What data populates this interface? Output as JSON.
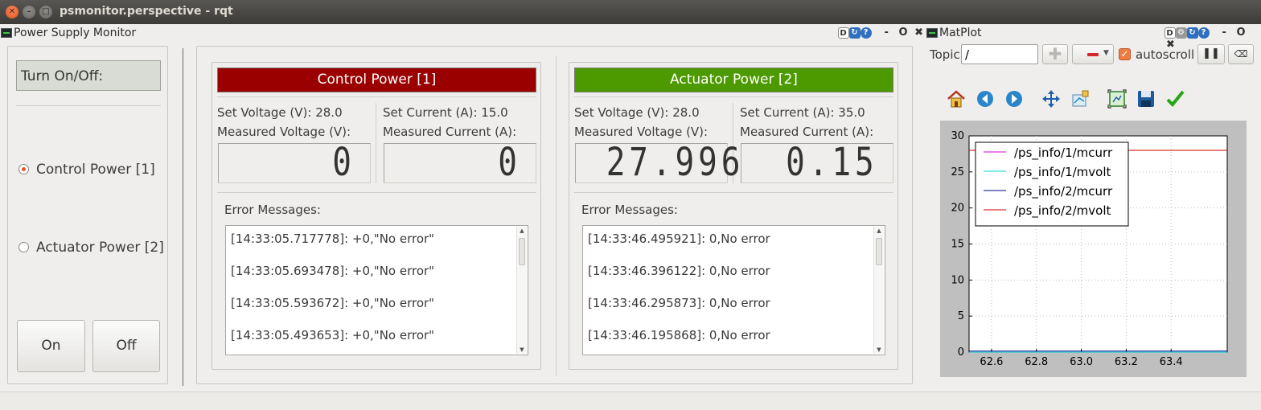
{
  "window": {
    "title": "psmonitor.perspective - rqt"
  },
  "psm": {
    "dock_title": "Power Supply Monitor",
    "turn_label": "Turn On/Off:",
    "radio_options": [
      {
        "label": "Control Power [1]",
        "checked": true
      },
      {
        "label": "Actuator Power [2]",
        "checked": false
      }
    ],
    "on_label": "On",
    "off_label": "Off",
    "supplies": [
      {
        "header": "Control Power [1]",
        "header_color": "#9b0000",
        "set_voltage_label": "Set Voltage (V): 28.0",
        "set_current_label": "Set Current (A): 15.0",
        "meas_voltage_label": "Measured Voltage (V):",
        "meas_current_label": "Measured Current (A):",
        "voltage_lcd": "0",
        "current_lcd": "0",
        "errors_label": "Error Messages:",
        "messages": [
          "[14:33:05.717778]: +0,\"No error\"",
          "[14:33:05.693478]: +0,\"No error\"",
          "[14:33:05.593672]: +0,\"No error\"",
          "[14:33:05.493653]: +0,\"No error\""
        ]
      },
      {
        "header": "Actuator Power [2]",
        "header_color": "#4c9a00",
        "set_voltage_label": "Set Voltage (V): 28.0",
        "set_current_label": "Set Current (A): 35.0",
        "meas_voltage_label": "Measured Voltage (V):",
        "meas_current_label": "Measured Current (A):",
        "voltage_lcd": "27.996",
        "current_lcd": "0.15",
        "errors_label": "Error Messages:",
        "messages": [
          "[14:33:46.495921]: 0,No error",
          "[14:33:46.396122]: 0,No error",
          "[14:33:46.295873]: 0,No error",
          "[14:33:46.195868]: 0,No error"
        ]
      }
    ]
  },
  "matplot": {
    "dock_title": "MatPlot",
    "topic_label": "Topic",
    "topic_value": "/",
    "autoscroll_label": "autoscroll",
    "autoscroll_checked": true,
    "toolbar_icons": [
      "home-icon",
      "back-icon",
      "forward-icon",
      "pan-icon",
      "subplots-icon",
      "zoom-icon",
      "save-icon",
      "check-icon"
    ]
  },
  "chart_data": {
    "type": "line",
    "xlim": [
      62.5,
      63.65
    ],
    "ylim": [
      0,
      30
    ],
    "xticks": [
      "62.6",
      "62.8",
      "63.0",
      "63.2",
      "63.4"
    ],
    "xtick_values": [
      62.6,
      62.8,
      63.0,
      63.2,
      63.4
    ],
    "yticks": [
      "0",
      "5",
      "10",
      "15",
      "20",
      "25",
      "30"
    ],
    "ytick_values": [
      0,
      5,
      10,
      15,
      20,
      25,
      30
    ],
    "grid": true,
    "legend_placement": "top-left",
    "series": [
      {
        "name": "/ps_info/1/mcurr",
        "color": "#d400d4",
        "x": [
          62.5,
          63.65
        ],
        "y": [
          0,
          0
        ]
      },
      {
        "name": "/ps_info/1/mvolt",
        "color": "#00d4d4",
        "x": [
          62.5,
          63.65
        ],
        "y": [
          0,
          0
        ]
      },
      {
        "name": "/ps_info/2/mcurr",
        "color": "#00008b",
        "x": [
          62.5,
          63.65
        ],
        "y": [
          0.15,
          0.15
        ]
      },
      {
        "name": "/ps_info/2/mvolt",
        "color": "#d00000",
        "x": [
          62.5,
          63.65
        ],
        "y": [
          27.996,
          27.996
        ]
      }
    ]
  }
}
